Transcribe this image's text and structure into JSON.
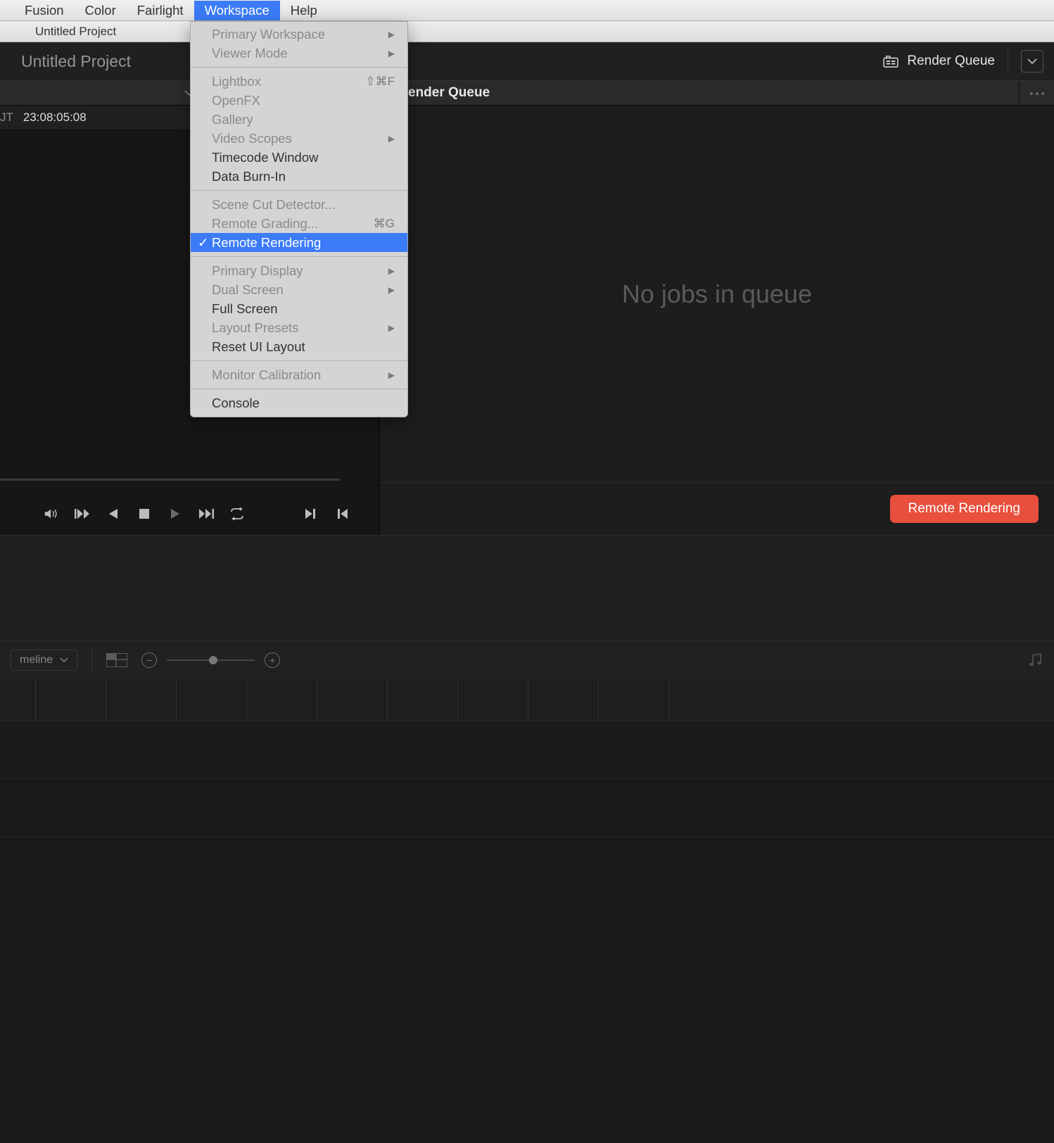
{
  "menubar": {
    "items": [
      "Fusion",
      "Color",
      "Fairlight",
      "Workspace",
      "Help"
    ],
    "active_index": 3
  },
  "titlebar": {
    "project": "Untitled Project"
  },
  "appheader": {
    "project_label": "Untitled Project",
    "render_queue_label": "Render Queue"
  },
  "timecode": {
    "ut_label": "JT",
    "value": "23:08:05:08"
  },
  "queue": {
    "header_label": "ender Queue",
    "empty_text": "No jobs in queue",
    "remote_button": "Remote Rendering"
  },
  "lower": {
    "timeline_label": "meline"
  },
  "workspace_menu": {
    "groups": [
      [
        {
          "label": "Primary Workspace",
          "disabled": true,
          "submenu": true
        },
        {
          "label": "Viewer Mode",
          "disabled": true,
          "submenu": true
        }
      ],
      [
        {
          "label": "Lightbox",
          "disabled": true,
          "shortcut": "⇧⌘F"
        },
        {
          "label": "OpenFX",
          "disabled": true
        },
        {
          "label": "Gallery",
          "disabled": true
        },
        {
          "label": "Video Scopes",
          "disabled": true,
          "submenu": true
        },
        {
          "label": "Timecode Window"
        },
        {
          "label": "Data Burn-In"
        }
      ],
      [
        {
          "label": "Scene Cut Detector...",
          "disabled": true
        },
        {
          "label": "Remote Grading...",
          "disabled": true,
          "shortcut": "⌘G"
        },
        {
          "label": "Remote Rendering",
          "selected": true
        }
      ],
      [
        {
          "label": "Primary Display",
          "disabled": true,
          "submenu": true
        },
        {
          "label": "Dual Screen",
          "disabled": true,
          "submenu": true
        },
        {
          "label": "Full Screen"
        },
        {
          "label": "Layout Presets",
          "disabled": true,
          "submenu": true
        },
        {
          "label": "Reset UI Layout"
        }
      ],
      [
        {
          "label": "Monitor Calibration",
          "disabled": true,
          "submenu": true
        }
      ],
      [
        {
          "label": "Console"
        }
      ]
    ]
  }
}
